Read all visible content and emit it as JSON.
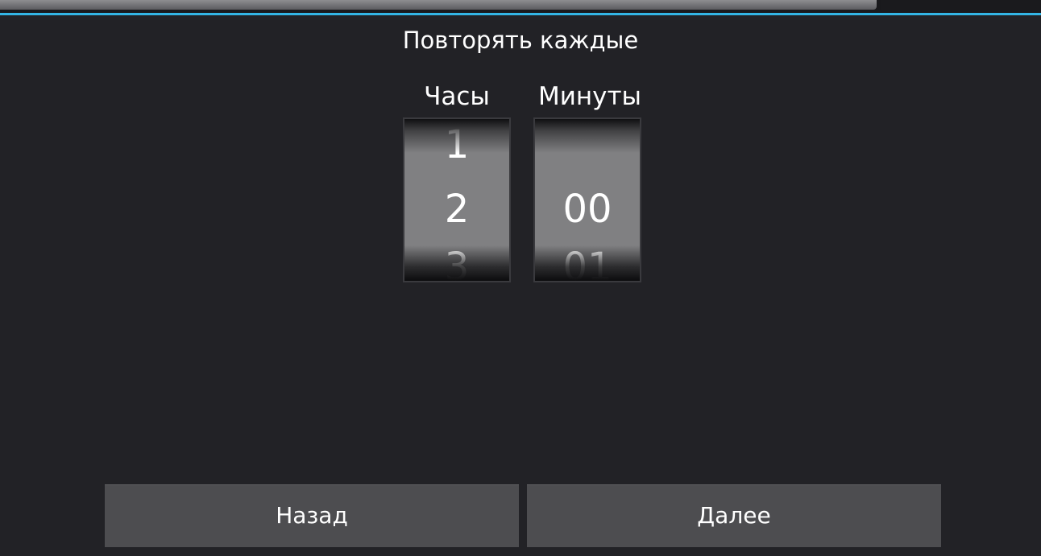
{
  "dialog": {
    "title": "Повторять каждые"
  },
  "hours_picker": {
    "label": "Часы",
    "previous": "1",
    "selected": "2",
    "next": "3"
  },
  "minutes_picker": {
    "label": "Минуты",
    "previous": "",
    "selected": "00",
    "next": "01"
  },
  "buttons": {
    "back_label": "Назад",
    "next_label": "Далее"
  },
  "colors": {
    "accent": "#33b5e5",
    "background": "#222226",
    "button": "#4d4d50"
  }
}
